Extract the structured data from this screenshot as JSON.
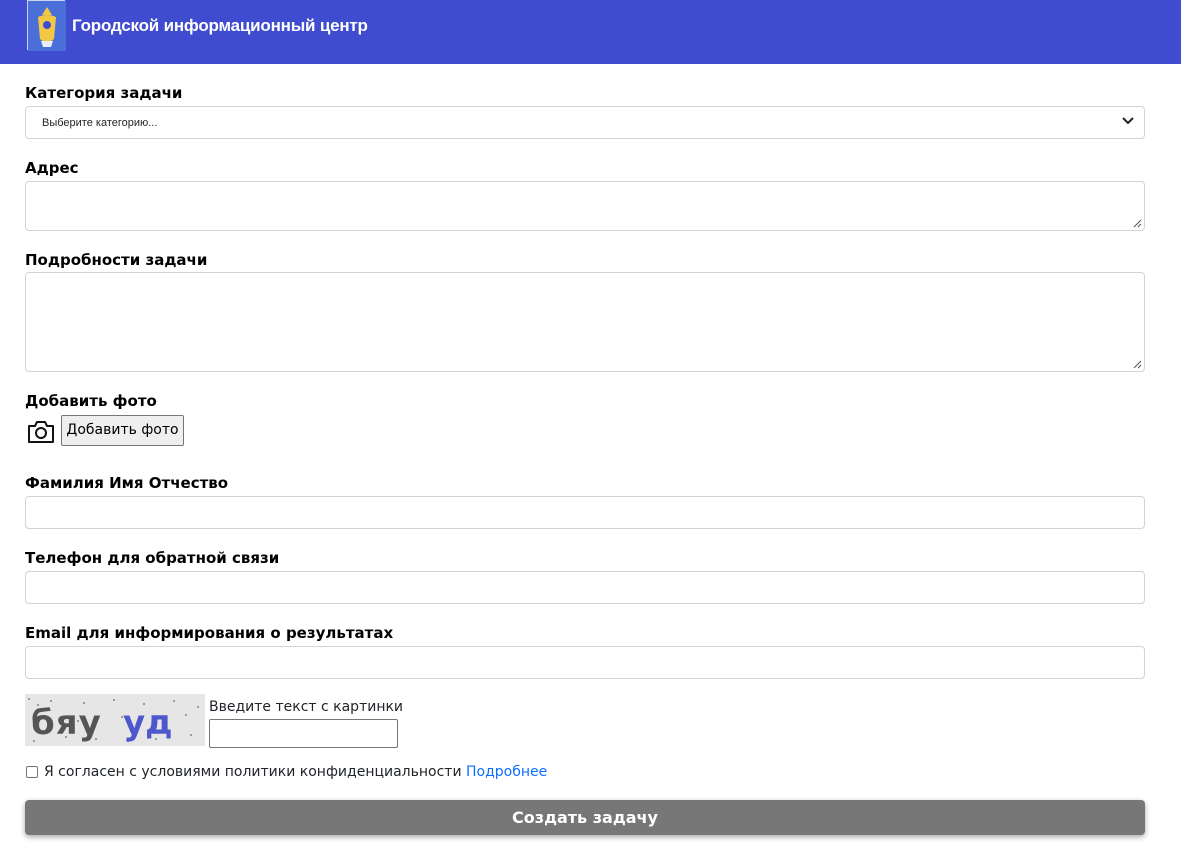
{
  "header": {
    "title": "Городской информационный центр",
    "background": "#3f4ccf"
  },
  "form": {
    "category": {
      "label": "Категория задачи",
      "selected": "Выберите категорию..."
    },
    "address": {
      "label": "Адрес",
      "value": ""
    },
    "details": {
      "label": "Подробности задачи",
      "value": ""
    },
    "photo": {
      "label": "Добавить фото",
      "button_label": "Добавить фото",
      "icon": "camera-icon"
    },
    "full_name": {
      "label": "Фамилия Имя Отчество",
      "value": ""
    },
    "phone": {
      "label": "Телефон для обратной связи",
      "value": ""
    },
    "email": {
      "label": "Email для информирования о результатах",
      "value": ""
    },
    "captcha": {
      "image_text": "бяууд",
      "label": "Введите текст с картинки",
      "value": ""
    },
    "consent": {
      "text": "Я согласен с условиями политики конфиденциальности",
      "link_label": "Подробнее",
      "checked": false
    },
    "submit_label": "Создать задачу",
    "submit_color": "#777777"
  }
}
